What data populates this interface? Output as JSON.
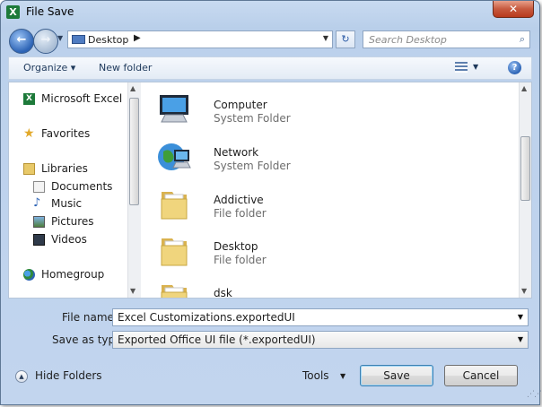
{
  "window": {
    "title": "File Save",
    "app_icon": "excel-icon",
    "close_label": "✕"
  },
  "nav": {
    "address_parts": [
      "Desktop"
    ],
    "search_placeholder": "Search Desktop"
  },
  "toolbar": {
    "organize_label": "Organize",
    "new_folder_label": "New folder"
  },
  "sidebar": {
    "items": [
      {
        "label": "Microsoft Excel",
        "icon": "excel-icon"
      },
      {
        "label": "Favorites",
        "icon": "star-icon"
      },
      {
        "label": "Libraries",
        "icon": "libraries-icon"
      },
      {
        "label": "Documents",
        "icon": "documents-icon"
      },
      {
        "label": "Music",
        "icon": "music-icon"
      },
      {
        "label": "Pictures",
        "icon": "pictures-icon"
      },
      {
        "label": "Videos",
        "icon": "videos-icon"
      },
      {
        "label": "Homegroup",
        "icon": "homegroup-icon"
      }
    ]
  },
  "files": [
    {
      "name": "Computer",
      "type": "System Folder",
      "icon": "computer-icon"
    },
    {
      "name": "Network",
      "type": "System Folder",
      "icon": "network-icon"
    },
    {
      "name": "Addictive",
      "type": "File folder",
      "icon": "folder-icon"
    },
    {
      "name": "Desktop",
      "type": "File folder",
      "icon": "folder-icon"
    },
    {
      "name": "dsk",
      "type": "",
      "icon": "folder-icon"
    }
  ],
  "form": {
    "file_name_label": "File name:",
    "file_name_value": "Excel Customizations.exportedUI",
    "save_type_label": "Save as type:",
    "save_type_value": "Exported Office UI file (*.exportedUI)"
  },
  "footer": {
    "hide_folders_label": "Hide Folders",
    "tools_label": "Tools",
    "save_label": "Save",
    "cancel_label": "Cancel"
  },
  "colors": {
    "accent": "#2c63b5",
    "folder": "#e8c969",
    "excel": "#1d7a3a"
  }
}
